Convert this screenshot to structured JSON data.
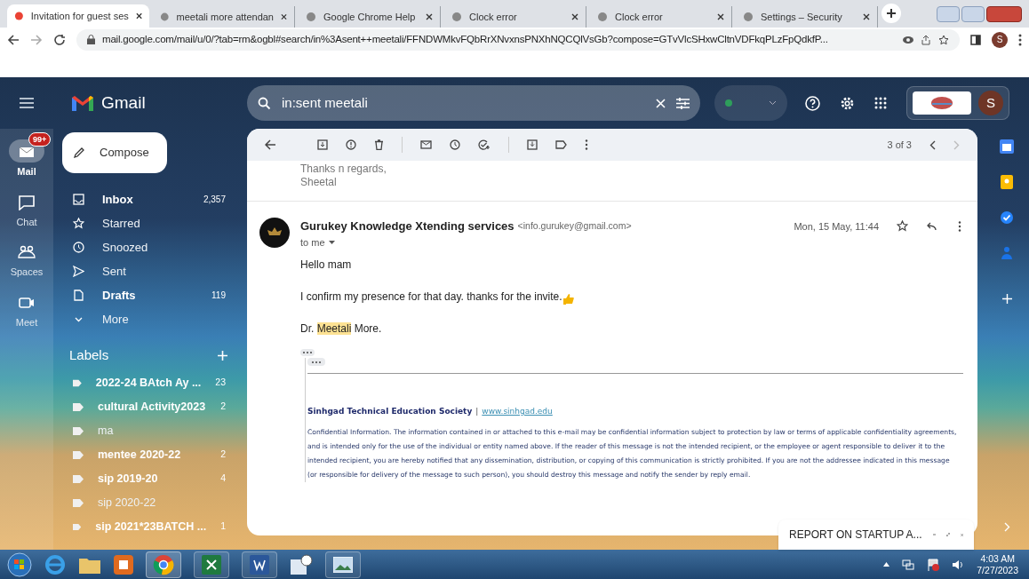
{
  "browser": {
    "tabs": [
      {
        "title": "Invitation for guest ses",
        "selected": true
      },
      {
        "title": "meetali more attendan",
        "selected": false
      },
      {
        "title": "Google Chrome Help",
        "selected": false
      },
      {
        "title": "Clock error",
        "selected": false
      },
      {
        "title": "Clock error",
        "selected": false
      },
      {
        "title": "Settings – Security",
        "selected": false
      }
    ],
    "url": "mail.google.com/mail/u/0/?tab=rm&ogbl#search/in%3Asent++meetali/FFNDWMkvFQbRrXNvxnsPNXhNQCQlVsGb?compose=GTvVlcSHxwCltnVDFkqPLzFpQdkfP...",
    "profile": "S"
  },
  "gmail": {
    "logo": "Gmail",
    "search": "in:sent meetali",
    "account": "S",
    "rail": [
      {
        "label": "Mail",
        "badge": "99+",
        "selected": true
      },
      {
        "label": "Chat",
        "selected": false
      },
      {
        "label": "Spaces",
        "selected": false
      },
      {
        "label": "Meet",
        "selected": false
      }
    ],
    "compose": "Compose",
    "nav": [
      {
        "label": "Inbox",
        "count": "2,357",
        "unread": true
      },
      {
        "label": "Starred",
        "unread": false
      },
      {
        "label": "Snoozed",
        "unread": false
      },
      {
        "label": "Sent",
        "unread": false
      },
      {
        "label": "Drafts",
        "count": "119",
        "unread": true
      },
      {
        "label": "More",
        "unread": false
      }
    ],
    "labels_title": "Labels",
    "labels": [
      {
        "label": "2022-24 BAtch Ay ...",
        "count": "23",
        "unread": true
      },
      {
        "label": "cultural Activity2023",
        "count": "2",
        "unread": true
      },
      {
        "label": "ma",
        "unread": false
      },
      {
        "label": "mentee 2020-22",
        "count": "2",
        "unread": true
      },
      {
        "label": "sip 2019-20",
        "count": "4",
        "unread": true
      },
      {
        "label": "sip 2020-22",
        "unread": false
      },
      {
        "label": "sip 2021*23BATCH ...",
        "count": "1",
        "unread": true
      }
    ],
    "pager": "3 of 3",
    "quote_tail": [
      "Thanks n regards,",
      "Sheetal"
    ],
    "message": {
      "sender": "Gurukey Knowledge Xtending services",
      "email": "<info.gurukey@gmail.com>",
      "date": "Mon, 15 May, 11:44",
      "to": "to me",
      "greeting": "Hello mam",
      "body": "I confirm my presence for that day. thanks for the invite.",
      "signature": {
        "before": "Dr.",
        "highlight": "Meetali",
        "after": "More."
      },
      "org": "Sinhgad Technical Education Society",
      "separator": "|",
      "website": "www.sinhgad.edu",
      "disclaimer": "Confidential Information. The information contained in or attached to this e-mail may be confidential information subject to protection by law or terms of applicable confidentiality agreements, and is intended only for the use of the individual or entity named above. If the reader of this message is not the intended recipient, or the employee or agent responsible to deliver it to the intended recipient, you are hereby notified that any dissemination, distribution, or copying of this communication is strictly prohibited. If you are not the addressee indicated in this message (or responsible for delivery of the message to such person), you should destroy this message and notify the sender by reply email."
    },
    "draft_popup": "REPORT ON STARTUP A..."
  },
  "taskbar": {
    "time": "4:03 AM",
    "date": "7/27/2023"
  }
}
